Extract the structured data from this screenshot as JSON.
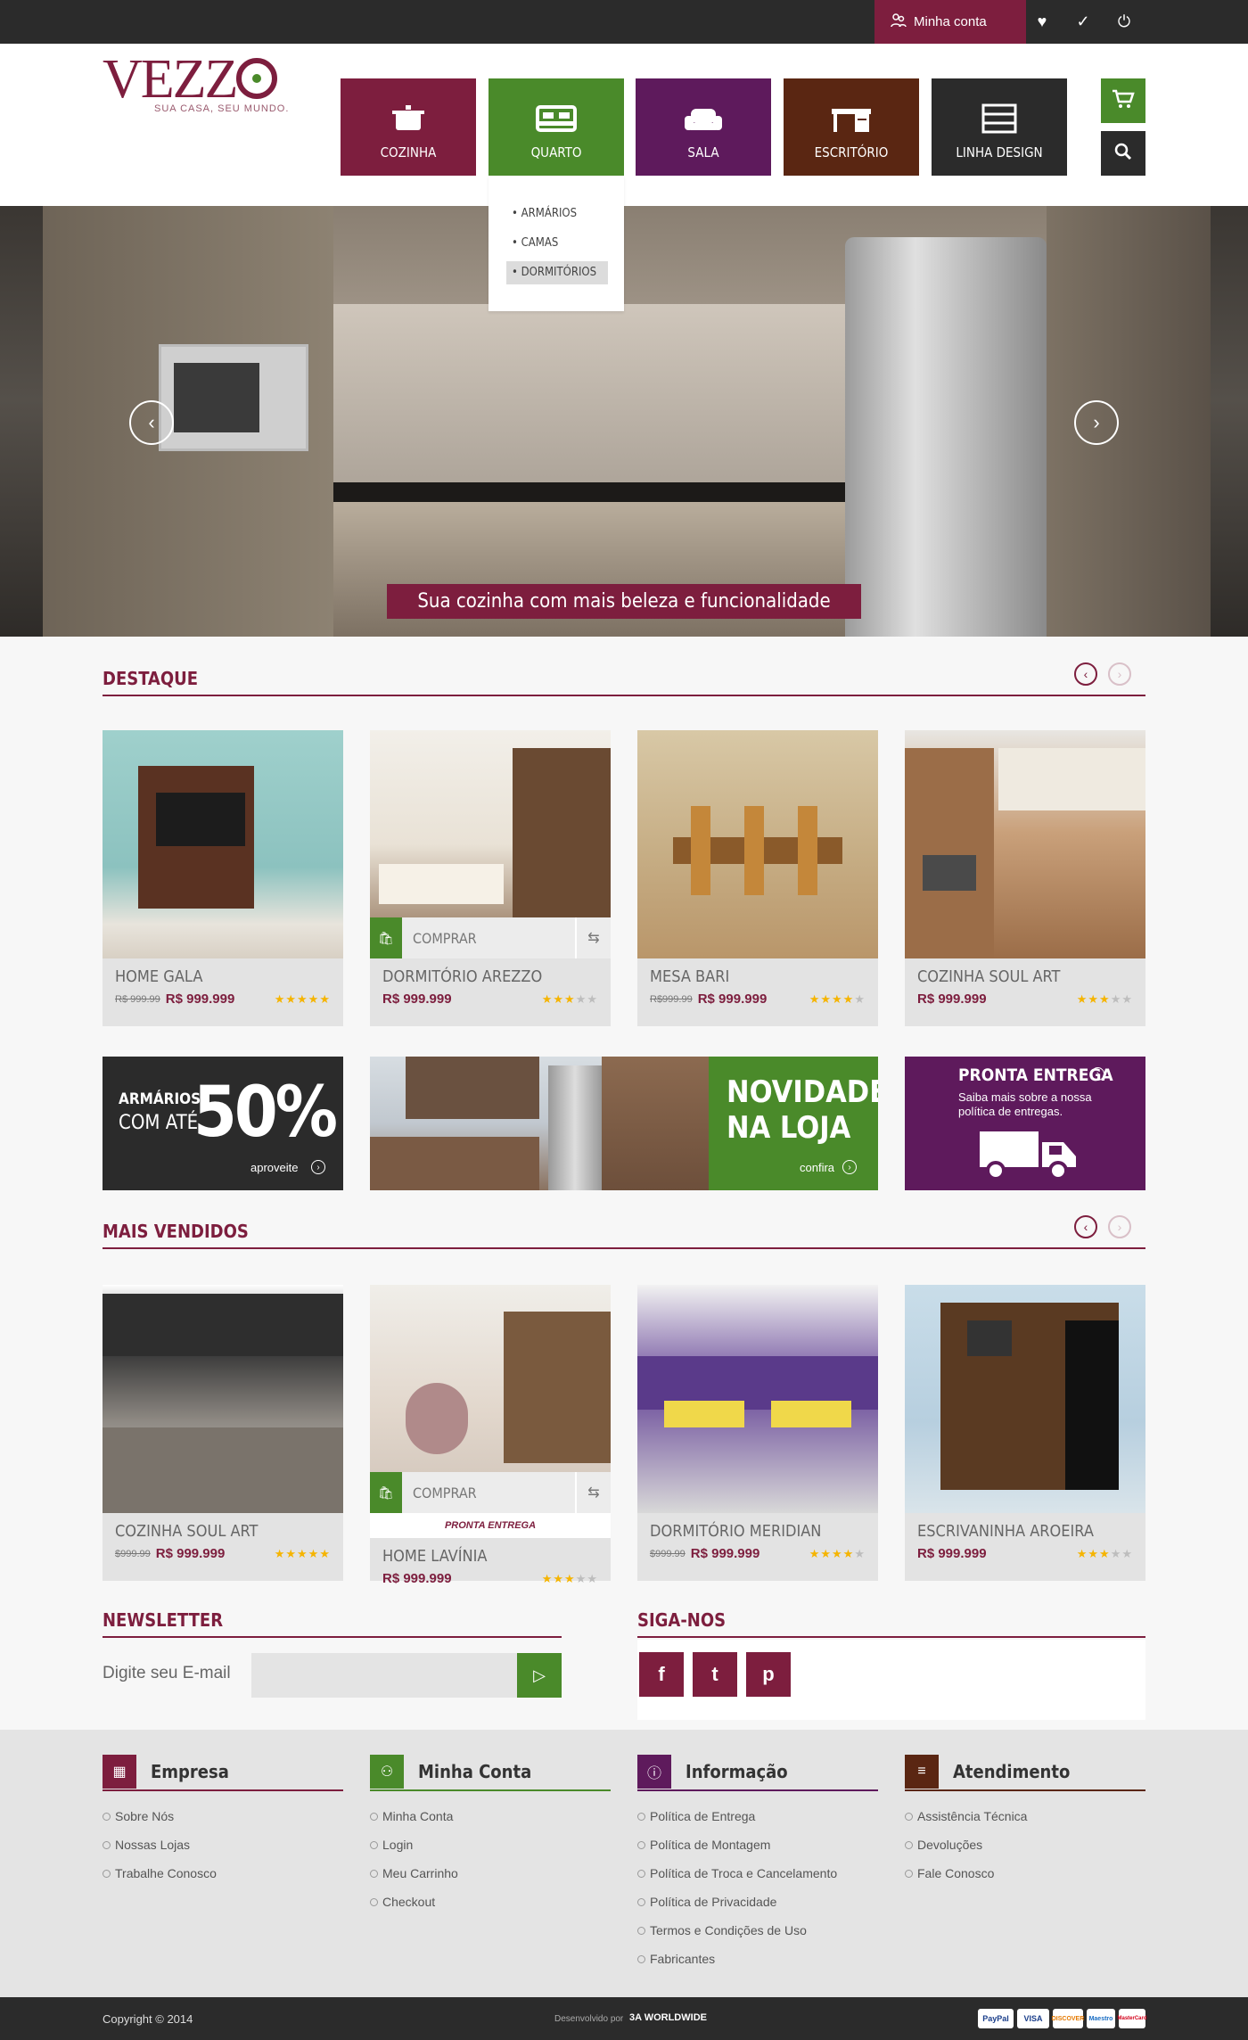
{
  "topbar": {
    "account_label": "Minha conta"
  },
  "logo": {
    "word": "VEZZ",
    "tagline": "SUA CASA, SEU MUNDO."
  },
  "nav": [
    {
      "label": "COZINHA",
      "color": "#7d1e3e",
      "icon": "pot-icon"
    },
    {
      "label": "QUARTO",
      "color": "#4a8a2a",
      "icon": "bed-icon"
    },
    {
      "label": "SALA",
      "color": "#5e1a5c",
      "icon": "sofa-icon"
    },
    {
      "label": "ESCRITÓRIO",
      "color": "#5a2612",
      "icon": "desk-icon"
    },
    {
      "label": "LINHA DESIGN",
      "color": "#2b2b2b",
      "icon": "dresser-icon"
    }
  ],
  "dropdown": [
    "• ARMÁRIOS",
    "• CAMAS",
    "• DORMITÓRIOS"
  ],
  "hero": {
    "caption": "Sua cozinha com mais beleza e funcionalidade"
  },
  "destaque": {
    "title": "DESTAQUE",
    "products": [
      {
        "name": "HOME GALA",
        "old": "R$ 999.99",
        "price": "R$ 999.999",
        "stars": 5
      },
      {
        "name": "DORMITÓRIO AREZZO",
        "old": "",
        "price": "R$ 999.999",
        "stars": 3,
        "buy": "COMPRAR"
      },
      {
        "name": "MESA BARI",
        "old": "R$999.99",
        "price": "R$ 999.999",
        "stars": 4
      },
      {
        "name": "COZINHA SOUL ART",
        "old": "",
        "price": "R$ 999.999",
        "stars": 3
      }
    ]
  },
  "banners": {
    "armarios_line1": "ARMÁRIOS",
    "armarios_line2": "COM ATÉ",
    "armarios_pct": "50%",
    "armarios_cta": "aproveite",
    "novidades_line1": "NOVIDADES",
    "novidades_line2": "NA LOJA",
    "novidades_cta": "confira",
    "pronta_title": "PRONTA ENTREGA",
    "pronta_text": "Saiba mais sobre a nossa política de entregas."
  },
  "mais_vendidos": {
    "title": "MAIS VENDIDOS",
    "products": [
      {
        "name": "COZINHA SOUL ART",
        "old": "$999.99",
        "price": "R$ 999.999",
        "stars": 5
      },
      {
        "name": "HOME LAVÍNIA",
        "old": "",
        "price": "R$ 999.999",
        "stars": 3,
        "buy": "COMPRAR",
        "ready": "PRONTA ENTREGA"
      },
      {
        "name": "DORMITÓRIO MERIDIAN",
        "old": "$999.99",
        "price": "R$ 999.999",
        "stars": 4
      },
      {
        "name": "ESCRIVANINHA AROEIRA",
        "old": "",
        "price": "R$ 999.999",
        "stars": 3
      }
    ]
  },
  "newsletter": {
    "title": "NEWSLETTER",
    "label": "Digite seu E-mail"
  },
  "social": {
    "title": "SIGA-NOS",
    "items": [
      "f",
      "t",
      "p"
    ]
  },
  "footer": {
    "columns": [
      {
        "title": "Empresa",
        "color": "#7d1e3e",
        "icon": "building-icon",
        "links": [
          "Sobre Nós",
          "Nossas Lojas",
          "Trabalhe Conosco"
        ]
      },
      {
        "title": "Minha Conta",
        "color": "#4a8a2a",
        "icon": "users-icon",
        "links": [
          "Minha Conta",
          "Login",
          "Meu Carrinho",
          "Checkout"
        ]
      },
      {
        "title": "Informação",
        "color": "#5e1a5c",
        "icon": "info-icon",
        "links": [
          "Política de Entrega",
          "Política de Montagem",
          "Política de Troca e Cancelamento",
          "Política de Privacidade",
          "Termos e Condições de Uso",
          "Fabricantes"
        ]
      },
      {
        "title": "Atendimento",
        "color": "#5a2612",
        "icon": "menu-icon",
        "links": [
          "Assistência Técnica",
          "Devoluções",
          "Fale Conosco"
        ]
      }
    ],
    "copyright": "Copyright © 2014",
    "dev_label": "Desenvolvido por",
    "dev_name": "3A WORLDWIDE",
    "payments": [
      "PayPal",
      "VISA",
      "DISCOVER",
      "Maestro",
      "MasterCard"
    ]
  }
}
